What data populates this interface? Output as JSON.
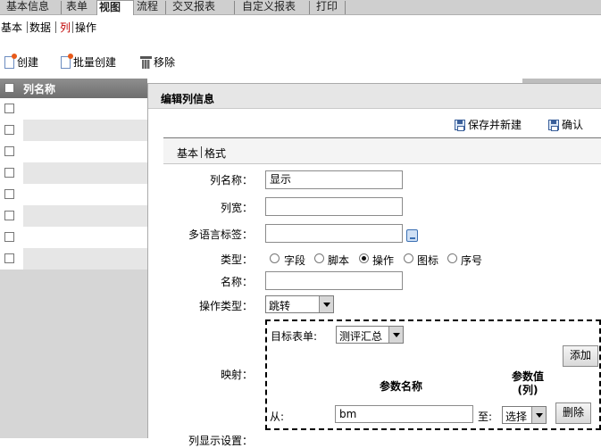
{
  "top_tabs": [
    "基本信息",
    "表单",
    "视图",
    "流程",
    "交叉报表",
    "自定义报表",
    "打印"
  ],
  "top_tabs_active": "视图",
  "sub_tabs": [
    "基本",
    "数据",
    "列",
    "操作"
  ],
  "sub_tabs_active": "列",
  "toolbar": {
    "create": "创建",
    "batch_create": "批量创建",
    "remove": "移除"
  },
  "list": {
    "header": "列名称",
    "row_count": 8
  },
  "dialog": {
    "title": "编辑列信息",
    "save_new": "保存并新建",
    "confirm": "确认",
    "tabs": [
      "基本",
      "格式"
    ],
    "fields": {
      "col_name_label": "列名称：",
      "col_name_value": "显示",
      "width_label": "列宽：",
      "width_value": "",
      "multilang_label": "多语言标签：",
      "multilang_value": "",
      "type_label": "类型：",
      "type_options": [
        "字段",
        "脚本",
        "操作",
        "图标",
        "序号"
      ],
      "type_selected": "操作",
      "name_label": "名称：",
      "name_value": "",
      "op_type_label": "操作类型：",
      "op_type_value": "跳转",
      "mapping_label": "映射：",
      "display_settings_label": "列显示设置："
    },
    "mapping": {
      "target_form_label": "目标表单:",
      "target_form_value": "测评汇总",
      "add_button": "添加",
      "param_name_header": "参数名称",
      "param_value_header": "参数值\n(列)",
      "from_label": "从:",
      "from_value": "bm",
      "to_label": "至:",
      "to_value": "选择",
      "delete_button": "删除"
    }
  }
}
